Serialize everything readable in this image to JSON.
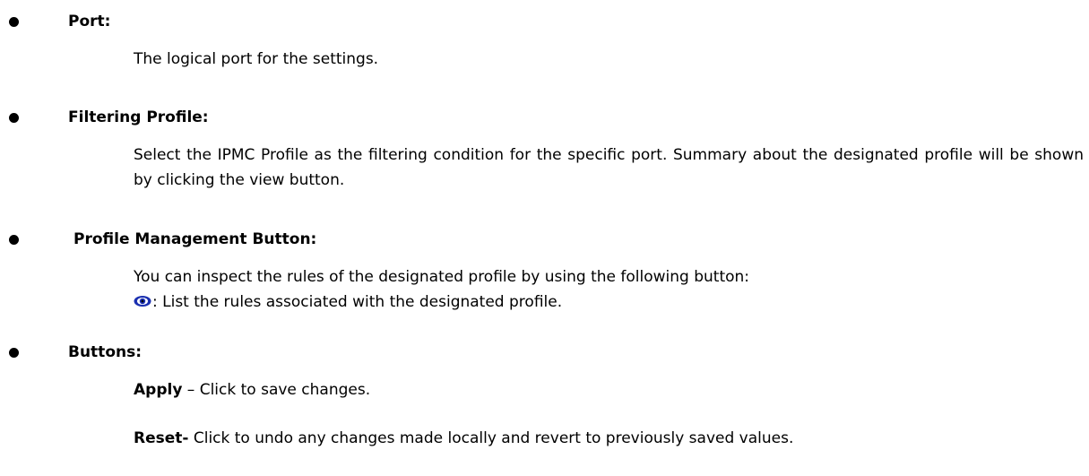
{
  "sections": {
    "port": {
      "heading": "Port:",
      "text": "The logical port for the settings."
    },
    "filtering_profile": {
      "heading": "Filtering Profile:",
      "text": "Select the IPMC Profile as the filtering condition for the specific port. Summary about the designated profile will be shown by clicking the view button."
    },
    "profile_management": {
      "heading": "Profile Management Button:",
      "intro": "You can inspect the rules of the designated profile by using the following button:",
      "icon": "eye-icon",
      "icon_text": ": List the rules associated with the designated profile."
    },
    "buttons": {
      "heading": "Buttons:",
      "apply_label": "Apply",
      "apply_text": " – Click to save changes.",
      "reset_label": "Reset-",
      "reset_text": " Click to undo any changes made locally and revert to previously saved values."
    }
  },
  "colors": {
    "text": "#000000",
    "eye_icon": "#1a2fb0"
  }
}
